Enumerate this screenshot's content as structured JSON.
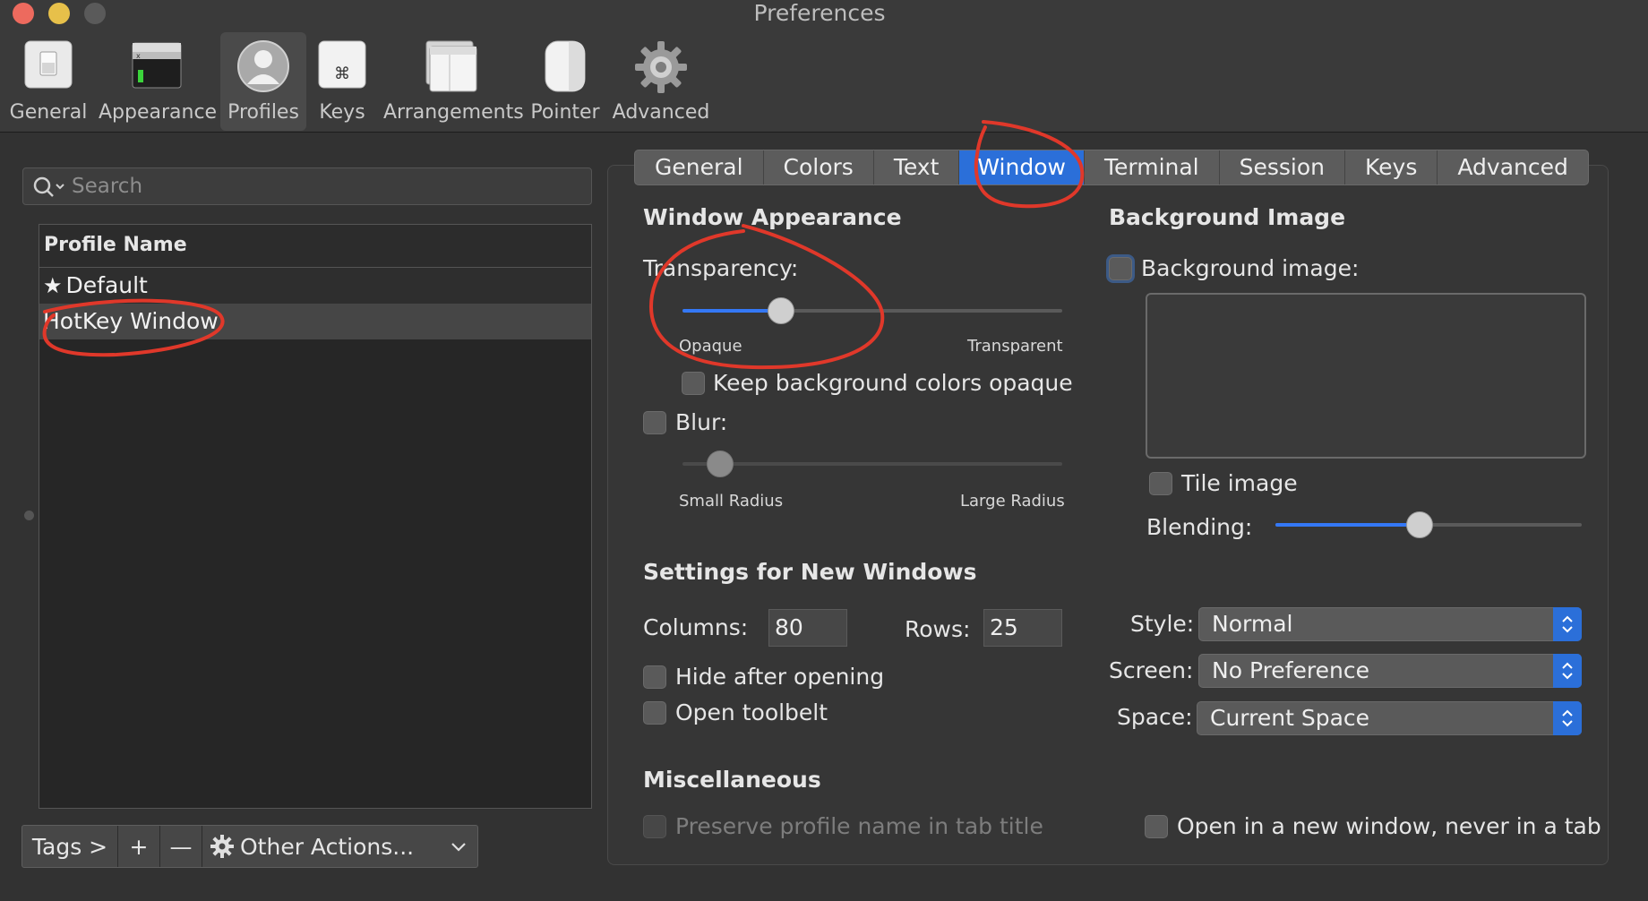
{
  "window": {
    "title": "Preferences"
  },
  "toolbar": {
    "items": [
      {
        "label": "General",
        "icon": "general-switch-icon"
      },
      {
        "label": "Appearance",
        "icon": "appearance-window-icon"
      },
      {
        "label": "Profiles",
        "icon": "profile-person-icon",
        "selected": true
      },
      {
        "label": "Keys",
        "icon": "command-key-icon"
      },
      {
        "label": "Arrangements",
        "icon": "arrangements-window-icon"
      },
      {
        "label": "Pointer",
        "icon": "mouse-icon"
      },
      {
        "label": "Advanced",
        "icon": "gear-icon"
      }
    ]
  },
  "sidebar": {
    "search": {
      "placeholder": "Search"
    },
    "table": {
      "header": "Profile Name",
      "rows": [
        {
          "label": "Default",
          "default": true
        },
        {
          "label": "HotKey Window",
          "selected": true
        }
      ]
    },
    "bottom_bar": {
      "tags": "Tags >",
      "add": "+",
      "remove": "—",
      "other_actions": "Other Actions..."
    }
  },
  "tabs": [
    {
      "label": "General"
    },
    {
      "label": "Colors"
    },
    {
      "label": "Text"
    },
    {
      "label": "Window",
      "active": true
    },
    {
      "label": "Terminal"
    },
    {
      "label": "Session"
    },
    {
      "label": "Keys"
    },
    {
      "label": "Advanced"
    }
  ],
  "window_appearance": {
    "title": "Window Appearance",
    "transparency_label": "Transparency:",
    "transparency_value": 0.26,
    "opaque_label": "Opaque",
    "transparent_label": "Transparent",
    "keep_bg_opaque": {
      "label": "Keep background colors opaque",
      "checked": false
    },
    "blur": {
      "label": "Blur:",
      "checked": false,
      "value": 0.1
    },
    "small_radius": "Small Radius",
    "large_radius": "Large Radius"
  },
  "background_image": {
    "title": "Background Image",
    "checkbox_label": "Background image:",
    "checked": false,
    "tile_image": {
      "label": "Tile image",
      "checked": false
    },
    "blending_label": "Blending:",
    "blending_value": 0.47
  },
  "new_windows": {
    "title": "Settings for New Windows",
    "columns_label": "Columns:",
    "columns": "80",
    "rows_label": "Rows:",
    "rows": "25",
    "hide_after_opening": {
      "label": "Hide after opening",
      "checked": false
    },
    "open_toolbelt": {
      "label": "Open toolbelt",
      "checked": false
    },
    "style_label": "Style:",
    "style": "Normal",
    "screen_label": "Screen:",
    "screen": "No Preference",
    "space_label": "Space:",
    "space": "Current Space"
  },
  "misc": {
    "title": "Miscellaneous",
    "preserve_profile_name": {
      "label": "Preserve profile name in tab title",
      "enabled": false
    },
    "open_new_window": {
      "label": "Open in a new window, never in a tab",
      "checked": false
    }
  },
  "colors": {
    "accent": "#2b6fd9",
    "annotation": "#e0382a"
  }
}
